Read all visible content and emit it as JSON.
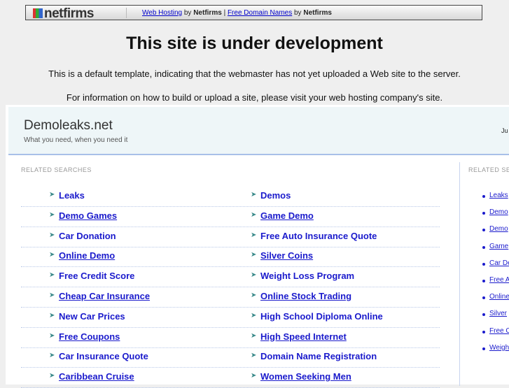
{
  "topbar": {
    "logo": "netfirms",
    "link1": "Web Hosting",
    "by1": "by",
    "brand1": "Netfirms",
    "pipe": "|",
    "link2": "Free Domain Names",
    "by2": "by",
    "brand2": "Netfirms"
  },
  "title": "This site is under development",
  "para1": "This is a default template, indicating that the webmaster has not yet uploaded a Web site to the server.",
  "para2": "For information on how to build or upload a site, please visit your web hosting company's site.",
  "site": {
    "name": "Demoleaks.net",
    "tagline": "What you need, when you need it",
    "right_text": "Ju"
  },
  "related_label": "RELATED SEARCHES",
  "related_label_right": "RELATED SEA",
  "col1": [
    "Leaks",
    "Demo Games",
    "Car Donation",
    "Online Demo",
    "Free Credit Score",
    "Cheap Car Insurance",
    "New Car Prices",
    "Free Coupons",
    "Car Insurance Quote",
    "Caribbean Cruise"
  ],
  "col2": [
    "Demos",
    "Game Demo",
    "Free Auto Insurance Quote",
    "Silver Coins",
    "Weight Loss Program",
    "Online Stock Trading",
    "High School Diploma Online",
    "High Speed Internet",
    "Domain Name Registration",
    "Women Seeking Men"
  ],
  "right_col": [
    "Leaks",
    "Demo",
    "Demo",
    "Game",
    "Car De",
    "Free A",
    "Online",
    "Silver",
    "Free C",
    "Weigh"
  ]
}
